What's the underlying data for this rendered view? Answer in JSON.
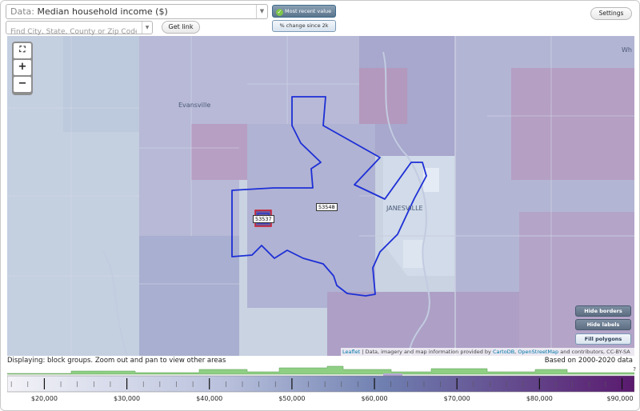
{
  "toolbar": {
    "data_prefix": "Data:",
    "data_selected": "Median household income ($)",
    "search_placeholder": "Find City, State, County or Zip Code",
    "get_link_label": "Get link",
    "most_recent_label": "Most recent value",
    "pct_change_label": "% change since 2k",
    "settings_label": "Settings"
  },
  "map": {
    "zoom_in": "+",
    "zoom_out": "−",
    "places": {
      "evansville": "Evansville",
      "janesville": "JANESVILLE",
      "corner": "Wh"
    },
    "zip_labels": {
      "zip_main": "53548",
      "zip_small": "53537"
    },
    "buttons": {
      "hide_borders": "Hide borders",
      "hide_labels": "Hide labels",
      "fill_polygons": "Fill polygons"
    },
    "attribution": {
      "leaflet": "Leaflet",
      "text": " | Data, imagery and map information provided by ",
      "cartodb": "CartoDB",
      "sep": ", ",
      "osm": "OpenStreetMap",
      "tail": " and contributors, CC-BY-SA"
    }
  },
  "status": {
    "displaying": "Displaying: block groups. Zoom out and pan to view other areas",
    "based_on": "Based on 2000-2020 data"
  },
  "legend": {
    "question_mark": "?",
    "ticks": [
      {
        "label": "$20,000",
        "value": 20000
      },
      {
        "label": "$30,000",
        "value": 30000
      },
      {
        "label": "$40,000",
        "value": 40000
      },
      {
        "label": "$50,000",
        "value": 50000
      },
      {
        "label": "$60,000",
        "value": 60000
      },
      {
        "label": "$70,000",
        "value": 70000
      },
      {
        "label": "$80,000",
        "value": 80000
      },
      {
        "label": "$90,000",
        "value": 90000
      }
    ],
    "colors": {
      "low": "#f3f3f8",
      "mid": "#6f7fb0",
      "high": "#5a1a6e",
      "histogram": "#8fcf84"
    }
  }
}
